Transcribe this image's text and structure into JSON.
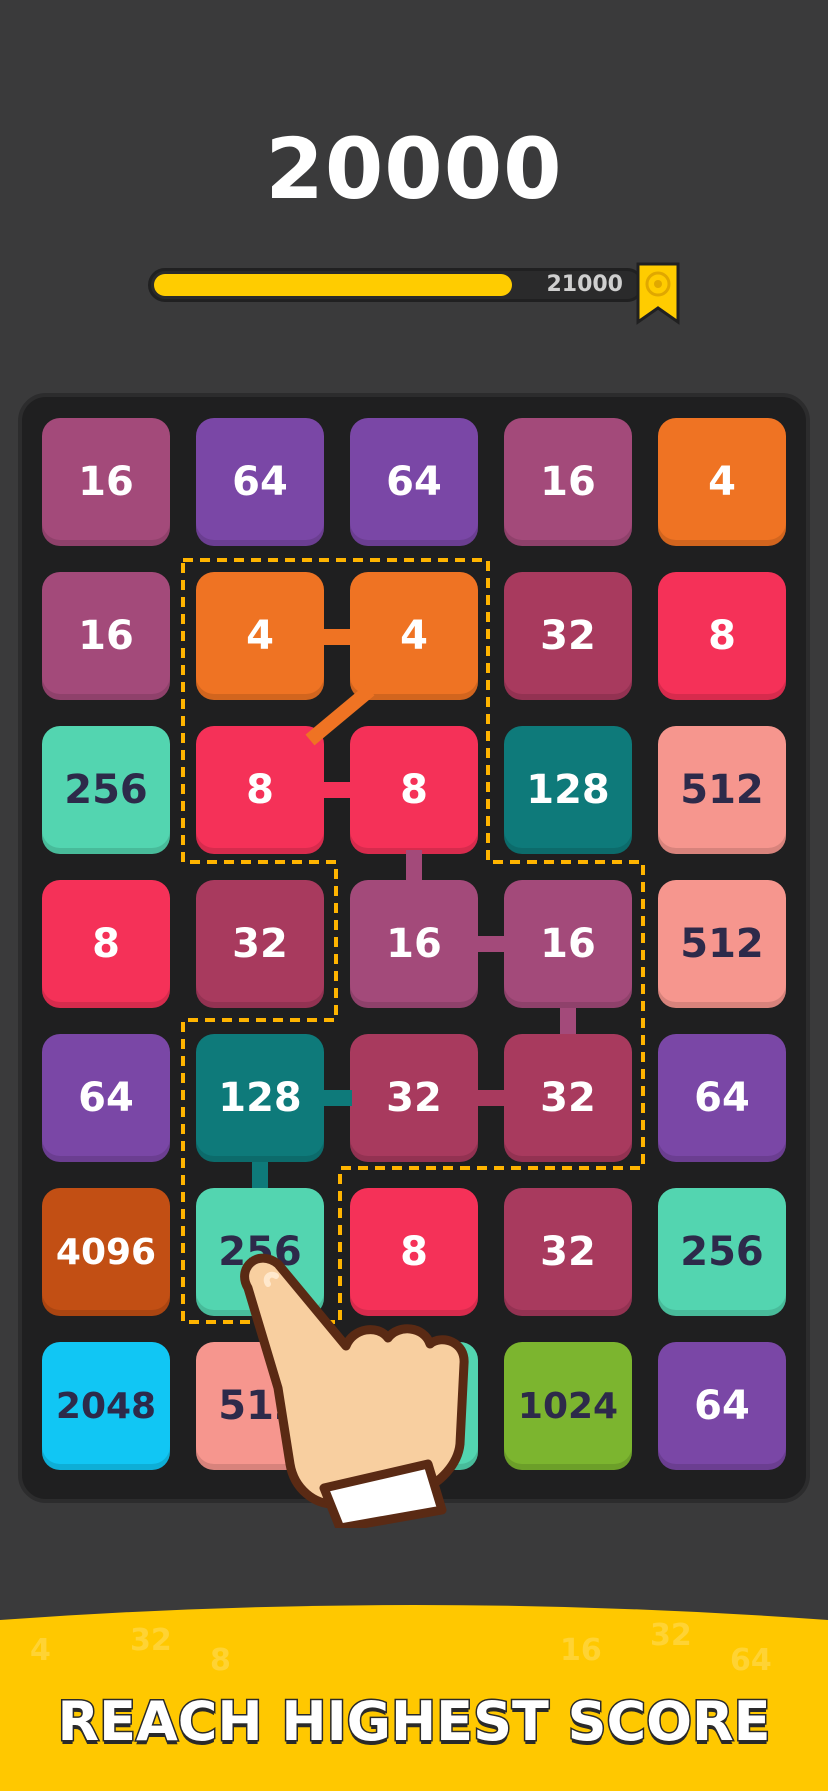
{
  "score": "20000",
  "progress": {
    "target_label": "21000",
    "fill_fraction": 0.74
  },
  "board": {
    "rows": [
      [
        {
          "v": "16",
          "c": "#a34a7a"
        },
        {
          "v": "64",
          "c": "#7a47a6"
        },
        {
          "v": "64",
          "c": "#7a47a6"
        },
        {
          "v": "16",
          "c": "#a34a7a"
        },
        {
          "v": "4",
          "c": "#ef7323"
        }
      ],
      [
        {
          "v": "16",
          "c": "#a34a7a"
        },
        {
          "v": "4",
          "c": "#ef7323"
        },
        {
          "v": "4",
          "c": "#ef7323"
        },
        {
          "v": "32",
          "c": "#a83a5e"
        },
        {
          "v": "8",
          "c": "#f53158"
        }
      ],
      [
        {
          "v": "256",
          "c": "#53d5b0",
          "dark": true
        },
        {
          "v": "8",
          "c": "#f53158"
        },
        {
          "v": "8",
          "c": "#f53158"
        },
        {
          "v": "128",
          "c": "#0e7a7a"
        },
        {
          "v": "512",
          "c": "#f6968e",
          "dark": true
        }
      ],
      [
        {
          "v": "8",
          "c": "#f53158"
        },
        {
          "v": "32",
          "c": "#a83a5e"
        },
        {
          "v": "16",
          "c": "#a34a7a"
        },
        {
          "v": "16",
          "c": "#a34a7a"
        },
        {
          "v": "512",
          "c": "#f6968e",
          "dark": true
        }
      ],
      [
        {
          "v": "64",
          "c": "#7a47a6"
        },
        {
          "v": "128",
          "c": "#0e7a7a"
        },
        {
          "v": "32",
          "c": "#a83a5e"
        },
        {
          "v": "32",
          "c": "#a83a5e"
        },
        {
          "v": "64",
          "c": "#7a47a6"
        }
      ],
      [
        {
          "v": "4096",
          "c": "#c24f14"
        },
        {
          "v": "256",
          "c": "#53d5b0",
          "dark": true
        },
        {
          "v": "8",
          "c": "#f53158"
        },
        {
          "v": "32",
          "c": "#a83a5e"
        },
        {
          "v": "256",
          "c": "#53d5b0",
          "dark": true
        }
      ],
      [
        {
          "v": "2048",
          "c": "#11c6f4",
          "dark": true
        },
        {
          "v": "512",
          "c": "#f6968e",
          "dark": true
        },
        {
          "v": "256",
          "c": "#53d5b0",
          "dark": true
        },
        {
          "v": "1024",
          "c": "#7cb52f",
          "dark": true
        },
        {
          "v": "64",
          "c": "#7a47a6"
        }
      ]
    ]
  },
  "banner": {
    "text": "REACH HIGHEST SCORE"
  },
  "colors": {
    "accent": "#ffcc00",
    "background": "#3a3a3b",
    "board": "#1f1f20",
    "dash": "#ffb400"
  },
  "icons": {
    "flag": "target-flag-icon",
    "hand": "pointing-hand-icon"
  }
}
